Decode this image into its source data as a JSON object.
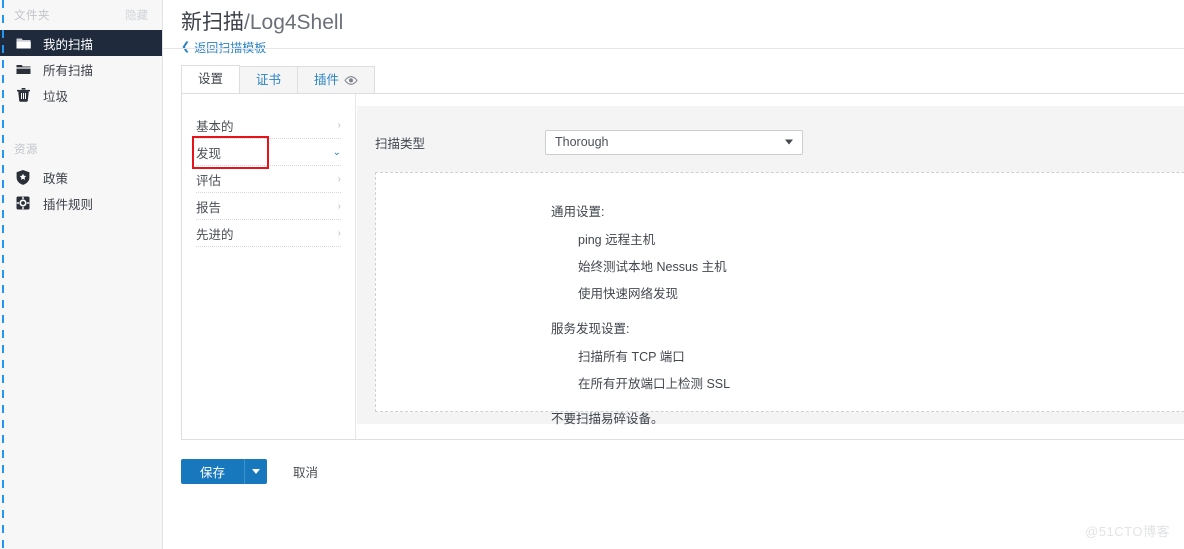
{
  "sidebar": {
    "folders": {
      "title": "文件夹",
      "action": "隐藏",
      "items": [
        {
          "label": "我的扫描",
          "icon": "folder-open-icon",
          "active": true
        },
        {
          "label": "所有扫描",
          "icon": "folder-icon",
          "active": false
        },
        {
          "label": "垃圾",
          "icon": "trash-icon",
          "active": false
        }
      ]
    },
    "resources": {
      "title": "资源",
      "items": [
        {
          "label": "政策",
          "icon": "shield-icon"
        },
        {
          "label": "插件规则",
          "icon": "plugin-rules-icon"
        }
      ]
    }
  },
  "header": {
    "title_main": "新扫描",
    "title_slug": "/Log4Shell",
    "back_link": "返回扫描模板",
    "back_chevron": "❮"
  },
  "tabs": [
    {
      "label": "设置",
      "active": true,
      "icon": null
    },
    {
      "label": "证书",
      "active": false,
      "icon": null
    },
    {
      "label": "插件",
      "active": false,
      "icon": "eye-icon"
    }
  ],
  "settings_nav": [
    {
      "label": "基本的",
      "arrow": "›",
      "expanded": false,
      "highlighted": false
    },
    {
      "label": "发现",
      "arrow": "⌄",
      "expanded": true,
      "highlighted": true
    },
    {
      "label": "评估",
      "arrow": "›",
      "expanded": false,
      "highlighted": false
    },
    {
      "label": "报告",
      "arrow": "›",
      "expanded": false,
      "highlighted": false
    },
    {
      "label": "先进的",
      "arrow": "›",
      "expanded": false,
      "highlighted": false
    }
  ],
  "panel": {
    "scan_type_label": "扫描类型",
    "scan_type_value": "Thorough",
    "groups": [
      {
        "heading": "通用设置:",
        "lines": [
          "ping 远程主机",
          "始终测试本地 Nessus 主机",
          "使用快速网络发现"
        ]
      },
      {
        "heading": "服务发现设置:",
        "lines": [
          "扫描所有 TCP 端口",
          "在所有开放端口上检测 SSL"
        ]
      }
    ],
    "note": "不要扫描易碎设备。"
  },
  "footer": {
    "save_label": "保存",
    "cancel_label": "取消"
  },
  "watermark": "@51CTO博客",
  "colors": {
    "accent": "#2b83c4",
    "primary_button": "#1878bd",
    "sidebar_active": "#1f2b3d",
    "highlight_box": "#e8121a",
    "panel_bg": "#f4f4f5"
  }
}
